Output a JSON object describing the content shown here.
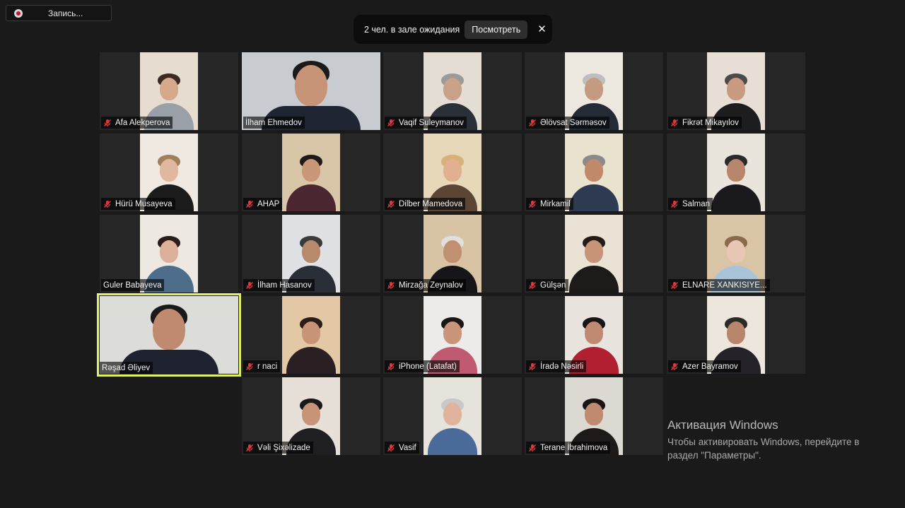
{
  "recording": {
    "label": "Запись..."
  },
  "waiting_room": {
    "text": "2 чел. в зале ожидания",
    "view_label": "Посмотреть",
    "close_symbol": "✕"
  },
  "participants": [
    {
      "name": "Afa Alekperova",
      "muted": true,
      "active": false
    },
    {
      "name": "İlham Ehmedov",
      "muted": false,
      "active": false
    },
    {
      "name": "Vaqif Suleymanov",
      "muted": true,
      "active": false
    },
    {
      "name": "Əlövsat Sərməsov",
      "muted": true,
      "active": false
    },
    {
      "name": "Fikrət Mikayılov",
      "muted": true,
      "active": false
    },
    {
      "name": "Hürü Musayeva",
      "muted": true,
      "active": false
    },
    {
      "name": "AHAP",
      "muted": true,
      "active": false
    },
    {
      "name": "Dilber Mamedova",
      "muted": true,
      "active": false
    },
    {
      "name": "Mirkamil",
      "muted": true,
      "active": false
    },
    {
      "name": "Salman",
      "muted": true,
      "active": false
    },
    {
      "name": "Guler Babayeva",
      "muted": false,
      "active": false
    },
    {
      "name": "İlham Hasanov",
      "muted": true,
      "active": false
    },
    {
      "name": "Mirzağa Zeynalov",
      "muted": true,
      "active": false
    },
    {
      "name": "Gülşən",
      "muted": true,
      "active": false
    },
    {
      "name": "ELNARE XANKISIYE...",
      "muted": true,
      "active": false
    },
    {
      "name": "Rəşad Əliyev",
      "muted": false,
      "active": true
    },
    {
      "name": "r naci",
      "muted": true,
      "active": false
    },
    {
      "name": "iPhone (Latafat)",
      "muted": true,
      "active": false
    },
    {
      "name": "İradə Nəsirli",
      "muted": true,
      "active": false
    },
    {
      "name": "Azer Bayramov",
      "muted": true,
      "active": false
    },
    {
      "name": "Vəli Şixəlizade",
      "muted": true,
      "active": false
    },
    {
      "name": "Vasif",
      "muted": true,
      "active": false
    },
    {
      "name": "Terane İbrahimova",
      "muted": true,
      "active": false
    }
  ],
  "activation": {
    "title": "Активация Windows",
    "subtitle": "Чтобы активировать Windows, перейдите в раздел \"Параметры\"."
  },
  "colors": {
    "active_speaker": "#dfee6b",
    "muted_icon": "#e0383e"
  }
}
